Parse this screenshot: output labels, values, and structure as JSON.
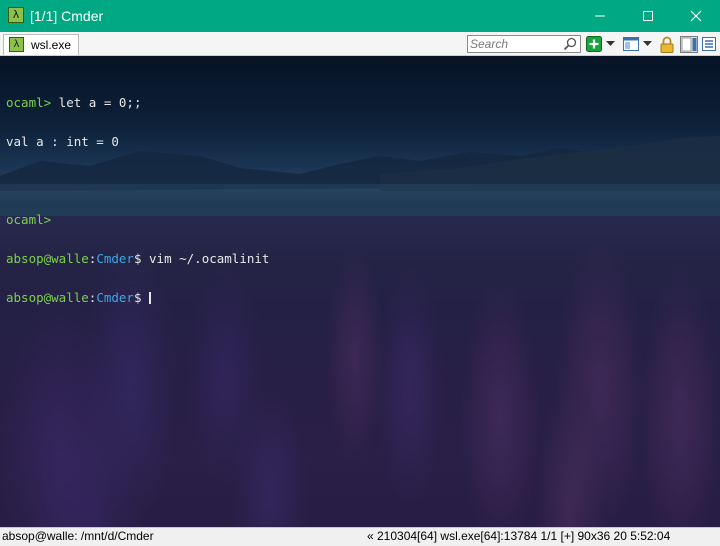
{
  "window": {
    "title": "[1/1] Cmder",
    "app_icon_glyph": "λ",
    "controls": {
      "minimize": "—",
      "maximize": "☐",
      "close": "✕"
    }
  },
  "tabbar": {
    "active_tab": {
      "label": "wsl.exe",
      "icon_glyph": "λ"
    },
    "search": {
      "placeholder": "Search",
      "value": ""
    },
    "buttons": [
      "add-console-icon",
      "dropdown-arrow-icon",
      "view-split-icon",
      "dropdown-arrow-icon",
      "lock-icon",
      "panel-toggle-icon",
      "hamburger-menu-icon"
    ]
  },
  "terminal": {
    "background": "night lake landscape with purple lupine flowers",
    "colors": {
      "prompt_green": "#7bd24a",
      "path_blue": "#3ba8e8",
      "text": "#e8e8e8"
    },
    "lines": [
      {
        "prompt": "ocaml>",
        "text": " let a = 0;;"
      },
      {
        "text": "val a : int = 0"
      },
      {
        "text": ""
      },
      {
        "prompt": "ocaml>",
        "text": ""
      },
      {
        "user": "absop@walle",
        "sep": ":",
        "dir": "Cmder",
        "dollar": "$",
        "cmd": " vim ~/.ocamlinit"
      },
      {
        "user": "absop@walle",
        "sep": ":",
        "dir": "Cmder",
        "dollar": "$",
        "cmd": " "
      }
    ]
  },
  "statusbar": {
    "left": "absop@walle: /mnt/d/Cmder",
    "right": "« 210304[64] wsl.exe[64]:13784   1/1   [+] 90x36  20   5:52:04"
  }
}
